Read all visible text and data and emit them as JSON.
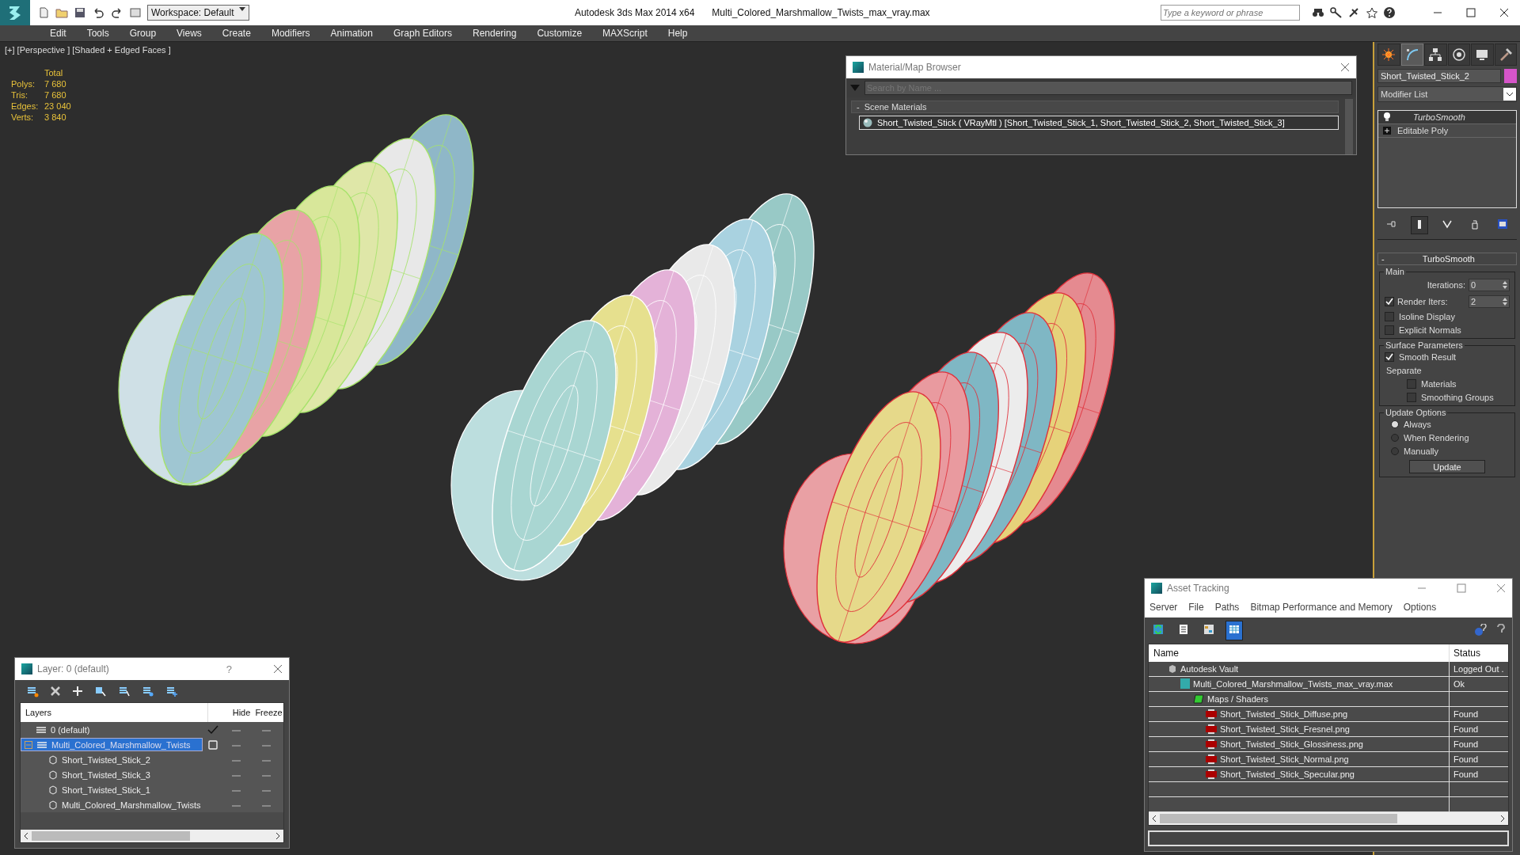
{
  "title_bar": {
    "workspace": "Workspace: Default",
    "title": "Autodesk 3ds Max  2014 x64",
    "filename": "Multi_Colored_Marshmallow_Twists_max_vray.max",
    "search_placeholder": "Type a keyword or phrase"
  },
  "menu": [
    "Edit",
    "Tools",
    "Group",
    "Views",
    "Create",
    "Modifiers",
    "Animation",
    "Graph Editors",
    "Rendering",
    "Customize",
    "MAXScript",
    "Help"
  ],
  "viewport": {
    "label": "[+] [Perspective ] [Shaded + Edged Faces ]",
    "stats_header": "Total",
    "stats": [
      {
        "label": "Polys:",
        "value": "7 680"
      },
      {
        "label": "Tris:",
        "value": "7 680"
      },
      {
        "label": "Edges:",
        "value": "23 040"
      },
      {
        "label": "Verts:",
        "value": "3 840"
      }
    ]
  },
  "material_browser": {
    "title": "Material/Map Browser",
    "search_placeholder": "Search by Name ...",
    "section_toggle": "-",
    "section": "Scene Materials",
    "items": [
      {
        "text": "Short_Twisted_Stick  ( VRayMtl ) [Short_Twisted_Stick_1, Short_Twisted_Stick_2, Short_Twisted_Stick_3]",
        "selected": true
      }
    ]
  },
  "command_panel": {
    "tabs": [
      {
        "kind": "create",
        "selected": false
      },
      {
        "kind": "modify",
        "selected": true
      },
      {
        "kind": "hierarchy",
        "selected": false
      },
      {
        "kind": "motion",
        "selected": false
      },
      {
        "kind": "display",
        "selected": false
      },
      {
        "kind": "utilities",
        "selected": false
      }
    ],
    "object_name": "Short_Twisted_Stick_2",
    "modifier_list": "Modifier List",
    "stack": [
      {
        "name": "TurboSmooth",
        "kind": "modifier",
        "selected": true
      },
      {
        "name": "Editable Poly",
        "kind": "base",
        "selected": false
      }
    ],
    "stack_tools": [
      {
        "kind": "pin",
        "selected": false
      },
      {
        "kind": "end-result",
        "selected": true
      },
      {
        "kind": "unique",
        "selected": false
      },
      {
        "kind": "remove",
        "selected": false
      },
      {
        "kind": "configure",
        "selected": false
      }
    ],
    "rollout": {
      "toggle": "-",
      "title": "TurboSmooth",
      "groups": [
        {
          "title": "Main",
          "items": [
            {
              "kind": "spinner",
              "label": "Iterations:",
              "value": "0"
            },
            {
              "kind": "check_spinner",
              "label": "Render Iters:",
              "value": "2",
              "checked": true
            },
            {
              "kind": "check",
              "label": "Isoline Display",
              "checked": false
            },
            {
              "kind": "check",
              "label": "Explicit Normals",
              "checked": false
            }
          ]
        },
        {
          "title": "Surface Parameters",
          "items": [
            {
              "kind": "check",
              "label": "Smooth Result",
              "checked": true
            },
            {
              "kind": "label",
              "label": "Separate"
            },
            {
              "kind": "subcheck",
              "label": "Materials",
              "checked": false
            },
            {
              "kind": "subcheck",
              "label": "Smoothing Groups",
              "checked": false
            }
          ]
        },
        {
          "title": "Update Options",
          "items": [
            {
              "kind": "radio",
              "label": "Always",
              "selected": true
            },
            {
              "kind": "radio",
              "label": "When Rendering",
              "selected": false
            },
            {
              "kind": "radio",
              "label": "Manually",
              "selected": false
            },
            {
              "kind": "button",
              "label": "Update"
            }
          ]
        }
      ]
    }
  },
  "layers": {
    "title": "Layer: 0 (default)",
    "help": "?",
    "columns": [
      "Layers",
      "Hide",
      "Freeze"
    ],
    "rows": [
      {
        "name": "0 (default)",
        "kind": "layer",
        "current": true,
        "selected": false
      },
      {
        "name": "Multi_Colored_Marshmallow_Twists",
        "kind": "layer",
        "current": false,
        "selected": true,
        "expanded": true,
        "children": [
          {
            "name": "Short_Twisted_Stick_2",
            "kind": "object",
            "selected": false
          },
          {
            "name": "Short_Twisted_Stick_3",
            "kind": "object",
            "selected": false
          },
          {
            "name": "Short_Twisted_Stick_1",
            "kind": "object",
            "selected": false
          },
          {
            "name": "Multi_Colored_Marshmallow_Twists",
            "kind": "object",
            "selected": false
          }
        ]
      }
    ]
  },
  "asset_tracking": {
    "title": "Asset Tracking",
    "menu": [
      "Server",
      "File",
      "Paths",
      "Bitmap Performance and Memory",
      "Options"
    ],
    "toolbar": [
      {
        "kind": "refresh",
        "selected": false
      },
      {
        "kind": "list",
        "selected": false
      },
      {
        "kind": "thumbs",
        "selected": false
      },
      {
        "kind": "table",
        "selected": true
      }
    ],
    "columns": [
      "Name",
      "Status"
    ],
    "rows": [
      {
        "name": "Autodesk Vault",
        "kind": "vault",
        "status": "Logged Out .",
        "children": [
          {
            "name": "Multi_Colored_Marshmallow_Twists_max_vray.max",
            "kind": "max",
            "status": "Ok",
            "children": [
              {
                "name": "Maps / Shaders",
                "kind": "folder",
                "children": [
                  {
                    "name": "Short_Twisted_Stick_Diffuse.png",
                    "kind": "png",
                    "status": "Found"
                  },
                  {
                    "name": "Short_Twisted_Stick_Fresnel.png",
                    "kind": "png",
                    "status": "Found"
                  },
                  {
                    "name": "Short_Twisted_Stick_Glossiness.png",
                    "kind": "png",
                    "status": "Found"
                  },
                  {
                    "name": "Short_Twisted_Stick_Normal.png",
                    "kind": "png",
                    "status": "Found"
                  },
                  {
                    "name": "Short_Twisted_Stick_Specular.png",
                    "kind": "png",
                    "status": "Found"
                  }
                ]
              }
            ]
          }
        ]
      }
    ]
  }
}
